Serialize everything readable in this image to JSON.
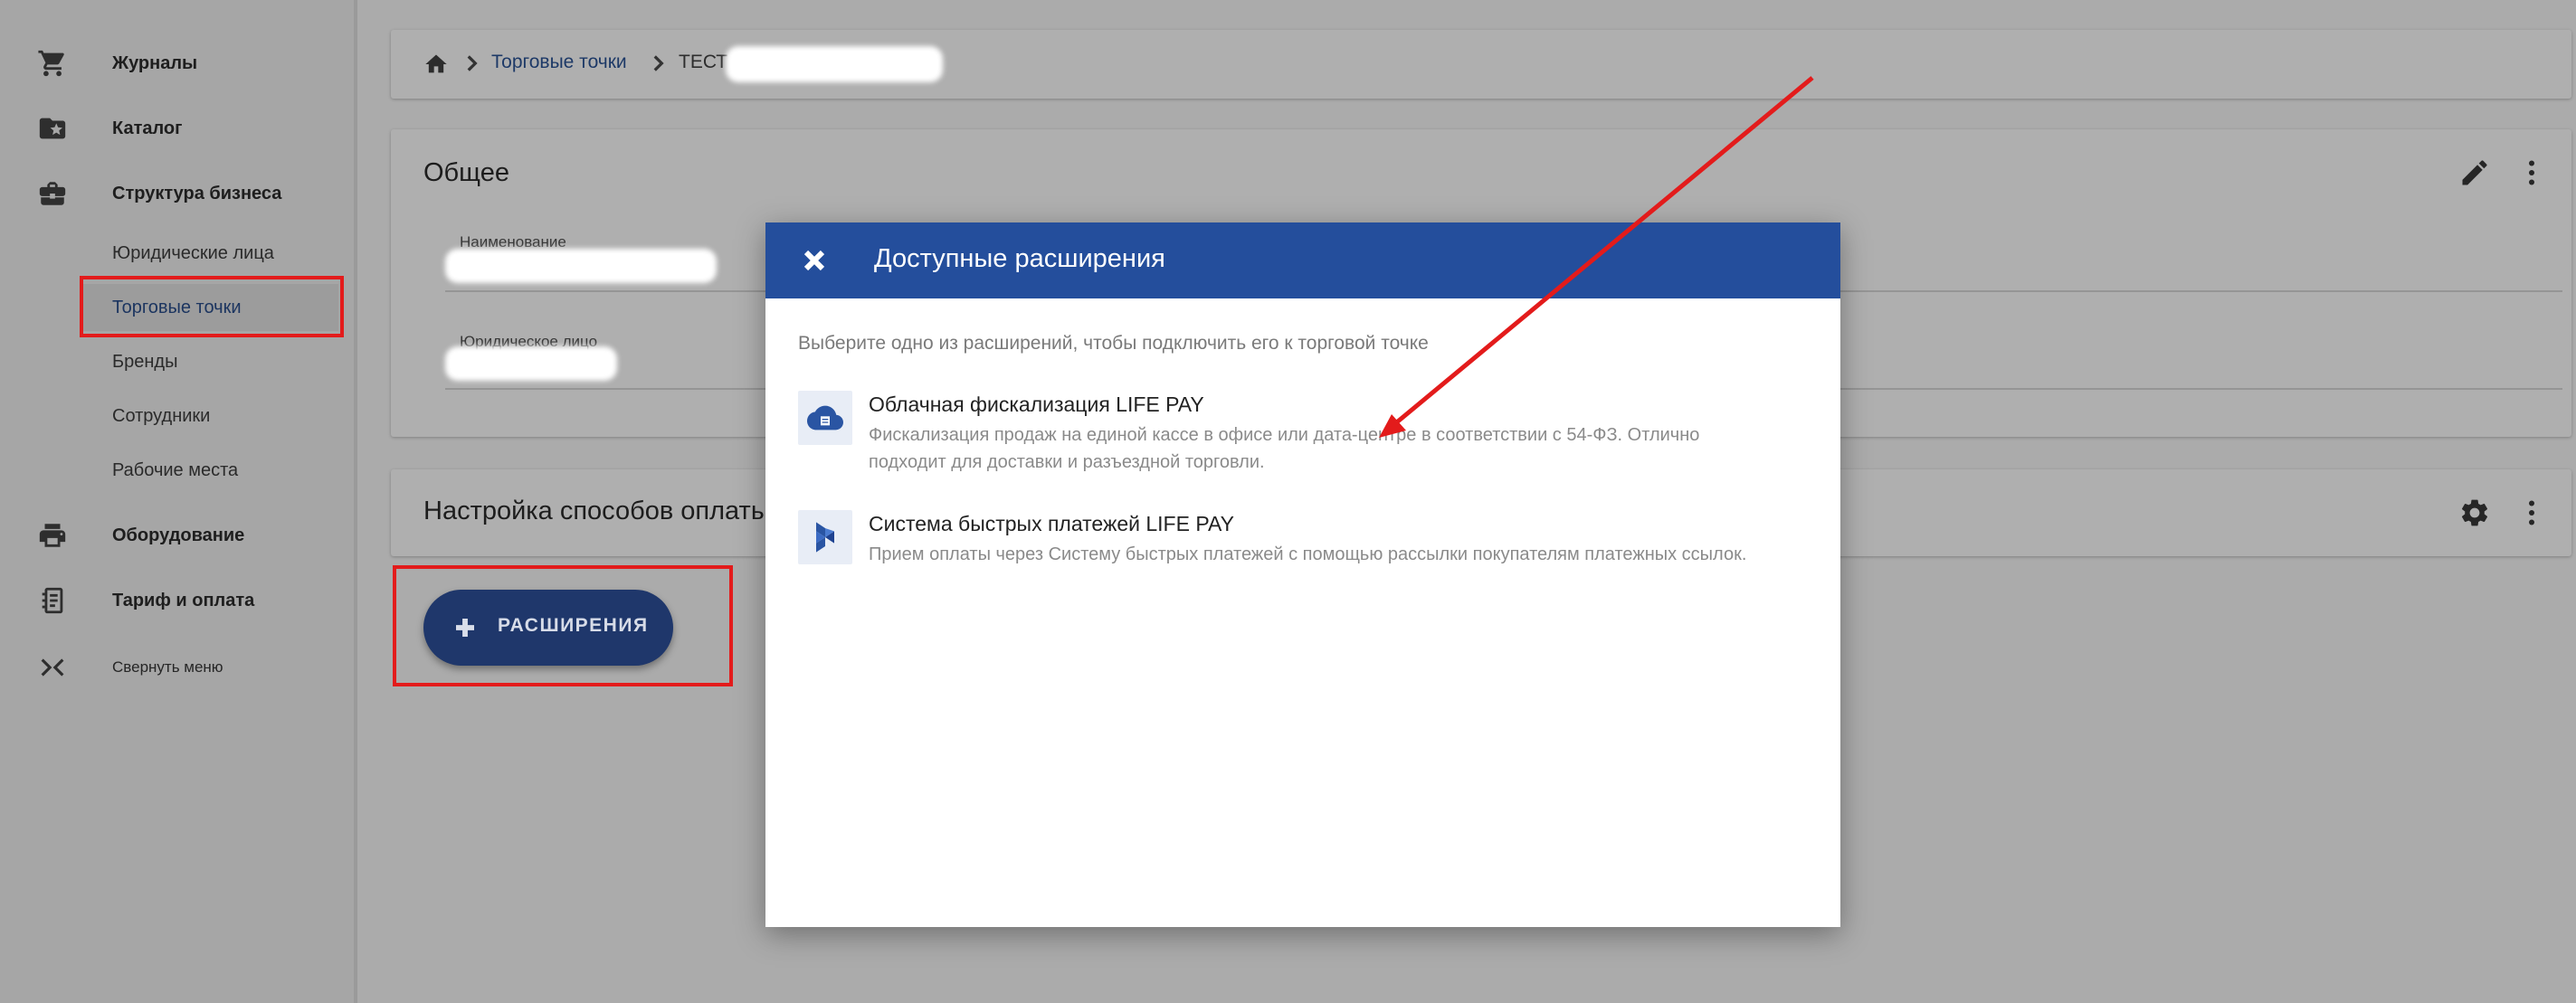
{
  "sidebar": {
    "items": [
      {
        "label": "Журналы",
        "icon": "cart-icon"
      },
      {
        "label": "Каталог",
        "icon": "folder-star-icon"
      },
      {
        "label": "Структура бизнеса",
        "icon": "briefcase-icon"
      },
      {
        "label": "Оборудование",
        "icon": "printer-icon"
      },
      {
        "label": "Тариф и оплата",
        "icon": "receipt-icon"
      }
    ],
    "subitems": [
      "Юридические лица",
      "Торговые точки",
      "Бренды",
      "Сотрудники",
      "Рабочие места"
    ],
    "active_subitem": "Торговые точки",
    "collapse_label": "Свернуть меню"
  },
  "breadcrumb": {
    "link": "Торговые точки",
    "current": "ТЕСТ"
  },
  "general_card": {
    "title": "Общее",
    "field1_label": "Наименование",
    "field2_label": "Юридическое лицо"
  },
  "payment_card": {
    "title": "Настройка способов оплаты"
  },
  "fab": {
    "label": "РАСШИРЕНИЯ"
  },
  "modal": {
    "title": "Доступные расширения",
    "hint": "Выберите одно из расширений, чтобы подключить его к торговой точке",
    "extensions": [
      {
        "title": "Облачная фискализация LIFE PAY",
        "description": "Фискализация продаж на единой кассе в офисе или дата-центре в соответствии с 54-ФЗ. Отлично подходит для доставки и разъездной торговли.",
        "icon": "cloud-register-icon"
      },
      {
        "title": "Система быстрых платежей LIFE PAY",
        "description": "Прием оплаты через Систему быстрых платежей с помощью рассылки покупателям платежных ссылок.",
        "icon": "sbp-logo-icon"
      }
    ]
  },
  "colors": {
    "accent": "#244e9c",
    "fab": "#1f376b",
    "annotation": "#e31b1b"
  }
}
